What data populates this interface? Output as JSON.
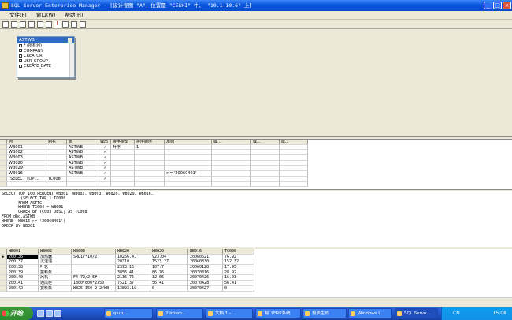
{
  "window": {
    "title": "SQL Server Enterprise Manager - [设计视图 \"A\"，位置是 \"CESHI\" 中、 \"10.1.10.6\" 上]",
    "min": "_",
    "max": "□",
    "close": "×"
  },
  "menu": [
    "文件(F)",
    "窗口(W)",
    "帮助(H)"
  ],
  "diagram": {
    "table_name": "ASTWB",
    "min_glyph": "-",
    "columns": [
      "* (所有列)",
      "COMPANY",
      "CREATOR",
      "USR_GROUP",
      "CREATE_DATE"
    ]
  },
  "grid": {
    "headers": [
      "列",
      "别名",
      "表",
      "输出",
      "排序类型",
      "排序顺序",
      "准则",
      "或...",
      "或...",
      "或..."
    ],
    "rows": [
      [
        "WB001",
        "",
        "ASTWB",
        "✓",
        "升序",
        "1",
        "",
        "",
        "",
        ""
      ],
      [
        "WB002",
        "",
        "ASTWB",
        "✓",
        "",
        "",
        "",
        "",
        "",
        ""
      ],
      [
        "WB003",
        "",
        "ASTWB",
        "✓",
        "",
        "",
        "",
        "",
        "",
        ""
      ],
      [
        "WB020",
        "",
        "ASTWB",
        "✓",
        "",
        "",
        "",
        "",
        "",
        ""
      ],
      [
        "WB029",
        "",
        "ASTWB",
        "✓",
        "",
        "",
        "",
        "",
        "",
        ""
      ],
      [
        "WB016",
        "",
        "ASTWB",
        "✓",
        "",
        "",
        ">= '20060401'",
        "",
        "",
        ""
      ],
      [
        "(SELECT TOP ...",
        "TC008",
        "",
        "✓",
        "",
        "",
        "",
        "",
        "",
        ""
      ],
      [
        "",
        "",
        "",
        "",
        "",
        "",
        "",
        "",
        "",
        ""
      ]
    ]
  },
  "sql": "SELECT TOP 100 PERCENT WB001, WB002, WB003, WB020, WB029, WB016,\n        (SELECT TOP 1 TC008\n       FROM ASTTC\n       WHERE TC004 = WB001\n       ORDER BY TC003 DESC) AS TC008\nFROM dbo.ASTWB\nWHERE (WB016 >= '20060401')\nORDER BY WB001",
  "results": {
    "headers": [
      "WB001",
      "WB002",
      "WB003",
      "WB020",
      "WB029",
      "WB016",
      "TC008"
    ],
    "rows": [
      [
        "200136",
        "加热器",
        "SRL17*10/2",
        "10256.41",
        "923.04",
        "20060621",
        "76.92"
      ],
      [
        "200137",
        "沉淀池",
        "",
        "20310",
        "1523.27",
        "20060830",
        "152.32"
      ],
      [
        "200138",
        "叶轮",
        "",
        "2393.16",
        "107.7",
        "20060128",
        "17.95"
      ],
      [
        "200139",
        "拔料泵",
        "",
        "3856.41",
        "86.76",
        "20070316",
        "28.92"
      ],
      [
        "200140",
        "风机",
        "F4-72/2.5#",
        "2136.75",
        "32.06",
        "20070426",
        "16.03"
      ],
      [
        "200141",
        "通风柜",
        "1800*800*2350",
        "7521.37",
        "56.41",
        "20070428",
        "56.41"
      ],
      [
        "200142",
        "拔料泵",
        "WB25-150-2.2/WB",
        "13893.16",
        "0",
        "20070427",
        "0"
      ]
    ],
    "current_marker": "▶"
  },
  "taskbar": {
    "start": "开始",
    "tasks": [
      "qiuru...",
      "2 Intern...",
      "文档 1 - ...",
      "易飞ERP系统",
      "报表生成",
      "Windows L...",
      "SQL Serve..."
    ],
    "tray_lang": "CN",
    "time": "15:08"
  }
}
